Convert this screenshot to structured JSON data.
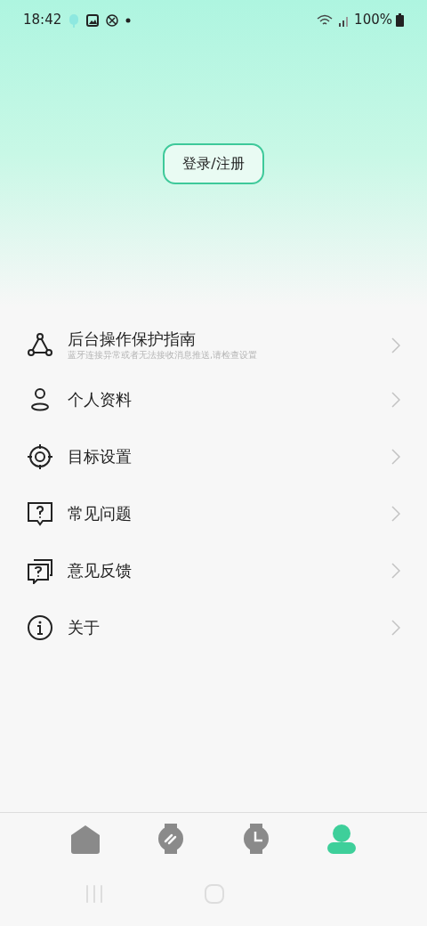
{
  "status_bar": {
    "time": "18:42",
    "battery": "100%"
  },
  "login_button": {
    "label": "登录/注册"
  },
  "menu": [
    {
      "kind": "triangle",
      "label": "后台操作保护指南",
      "subtitle": "蓝牙连接异常或者无法接收消息推送,请检查设置"
    },
    {
      "kind": "person",
      "label": "个人资料"
    },
    {
      "kind": "target",
      "label": "目标设置"
    },
    {
      "kind": "question",
      "label": "常见问题"
    },
    {
      "kind": "feedback",
      "label": "意见反馈"
    },
    {
      "kind": "info",
      "label": "关于"
    }
  ],
  "tab_bar": [
    {
      "kind": "home",
      "selected": false
    },
    {
      "kind": "watch-face",
      "selected": false
    },
    {
      "kind": "watch-clock",
      "selected": false
    },
    {
      "kind": "profile",
      "selected": true
    }
  ]
}
